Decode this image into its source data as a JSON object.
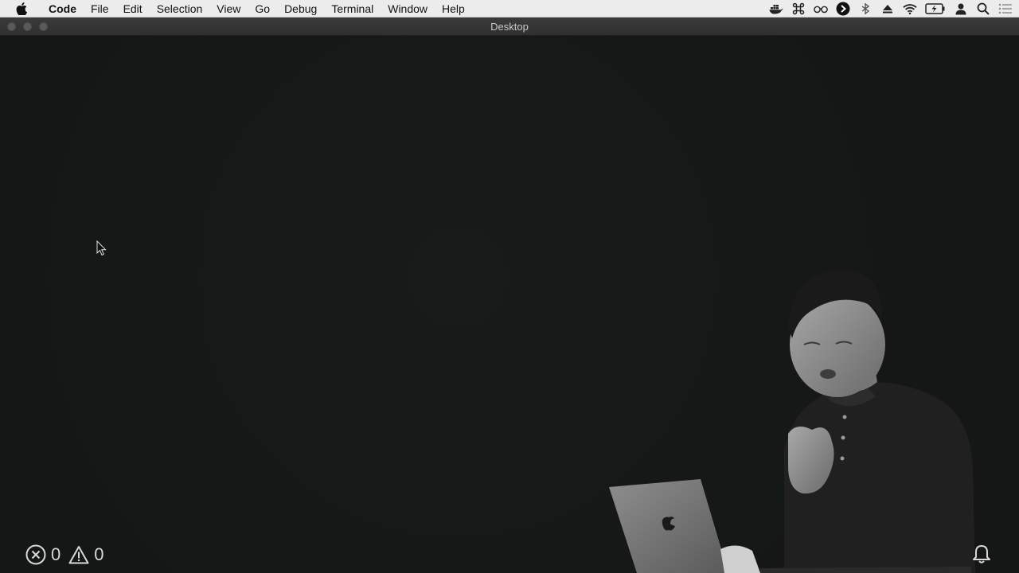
{
  "menubar": {
    "apple_icon": "apple-logo-icon",
    "items": [
      {
        "label": "Code",
        "app": true
      },
      {
        "label": "File"
      },
      {
        "label": "Edit"
      },
      {
        "label": "Selection"
      },
      {
        "label": "View"
      },
      {
        "label": "Go"
      },
      {
        "label": "Debug"
      },
      {
        "label": "Terminal"
      },
      {
        "label": "Window"
      },
      {
        "label": "Help"
      }
    ],
    "tray_icons": [
      "docker-icon",
      "command-icon",
      "glasses-icon",
      "play-circle-icon",
      "bluetooth-like-icon",
      "eject-icon",
      "wifi-icon",
      "battery-charging-icon",
      "user-icon",
      "search-icon",
      "notification-list-icon"
    ]
  },
  "window": {
    "title": "Desktop"
  },
  "status": {
    "errors": "0",
    "warnings": "0"
  },
  "colors": {
    "menubar_bg": "#ececec",
    "titlebar_bg": "#353535",
    "editor_bg": "#151817",
    "status_text": "#d8d8d8"
  }
}
